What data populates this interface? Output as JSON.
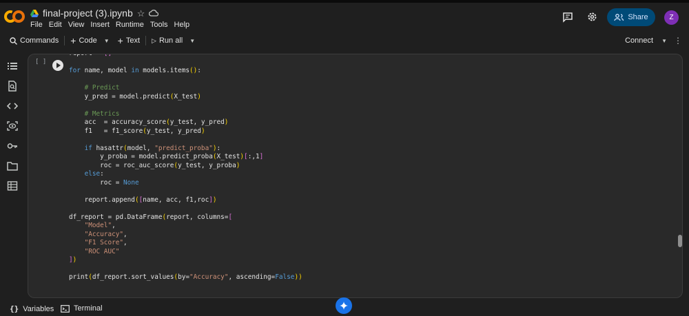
{
  "app": {
    "logo_text": "CO",
    "notebook_title": "final-project (3).ipynb"
  },
  "menu": [
    "File",
    "Edit",
    "View",
    "Insert",
    "Runtime",
    "Tools",
    "Help"
  ],
  "header": {
    "share_label": "Share",
    "avatar_initial": "Z"
  },
  "toolbar": {
    "commands_label": "Commands",
    "code_label": "Code",
    "text_label": "Text",
    "run_all_label": "Run all",
    "connect_label": "Connect"
  },
  "sidebar_icons": [
    "table-of-contents-icon",
    "find-replace-icon",
    "code-snippets-icon",
    "variables-inspector-icon",
    "secrets-key-icon",
    "files-folder-icon",
    "data-table-icon"
  ],
  "cell": {
    "brackets": "[ ]",
    "lines": [
      "report = []",
      "",
      "for name, model in models.items():",
      "",
      "    # Predict",
      "    y_pred = model.predict(X_test)",
      "",
      "    # Metrics",
      "    acc  = accuracy_score(y_test, y_pred)",
      "    f1   = f1_score(y_test, y_pred)",
      "",
      "    if hasattr(model, \"predict_proba\"):",
      "        y_proba = model.predict_proba(X_test)[:,1]",
      "        roc = roc_auc_score(y_test, y_proba)",
      "    else:",
      "        roc = None",
      "",
      "    report.append([name, acc, f1,roc])",
      "",
      "df_report = pd.DataFrame(report, columns=[",
      "    \"Model\",",
      "    \"Accuracy\",",
      "    \"F1 Score\",",
      "    \"ROC AUC\"",
      "])",
      "",
      "print(df_report.sort_values(by=\"Accuracy\", ascending=False))"
    ]
  },
  "statusbar": {
    "variables_label": "Variables",
    "terminal_label": "Terminal"
  },
  "colors": {
    "share_bg": "#004a77",
    "avatar_bg": "#7e2fb5",
    "logo_orange": "#f9ab00",
    "gemini_blue": "#1a73e8"
  }
}
